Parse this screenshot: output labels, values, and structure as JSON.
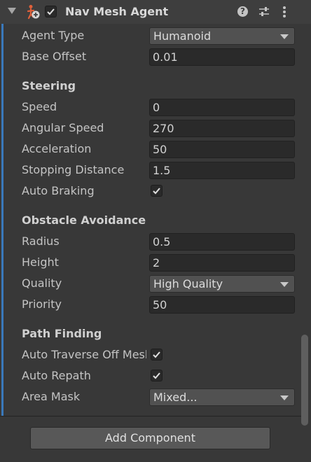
{
  "component": {
    "title": "Nav Mesh Agent",
    "enabled": true,
    "icons": {
      "agent": "nav-mesh-agent-icon",
      "help": "help-icon",
      "presets": "presets-sliders-icon",
      "menu": "kebab-menu-icon"
    },
    "help_glyph": "?"
  },
  "properties": {
    "agent_type": {
      "label": "Agent Type",
      "value": "Humanoid"
    },
    "base_offset": {
      "label": "Base Offset",
      "value": "0.01"
    }
  },
  "steering": {
    "title": "Steering",
    "speed": {
      "label": "Speed",
      "value": "0"
    },
    "angular_speed": {
      "label": "Angular Speed",
      "value": "270"
    },
    "acceleration": {
      "label": "Acceleration",
      "value": "50"
    },
    "stopping_distance": {
      "label": "Stopping Distance",
      "value": "1.5"
    },
    "auto_braking": {
      "label": "Auto Braking",
      "checked": true
    }
  },
  "obstacle_avoidance": {
    "title": "Obstacle Avoidance",
    "radius": {
      "label": "Radius",
      "value": "0.5"
    },
    "height": {
      "label": "Height",
      "value": "2"
    },
    "quality": {
      "label": "Quality",
      "value": "High Quality"
    },
    "priority": {
      "label": "Priority",
      "value": "50"
    }
  },
  "path_finding": {
    "title": "Path Finding",
    "auto_traverse": {
      "label": "Auto Traverse Off Mesh Link",
      "checked": true
    },
    "auto_repath": {
      "label": "Auto Repath",
      "checked": true
    },
    "area_mask": {
      "label": "Area Mask",
      "value": "Mixed..."
    }
  },
  "add_component_label": "Add Component",
  "colors": {
    "accent": "#3a79bb",
    "background": "#383838",
    "field": "#2a2a2a",
    "dropdown": "#515151"
  }
}
